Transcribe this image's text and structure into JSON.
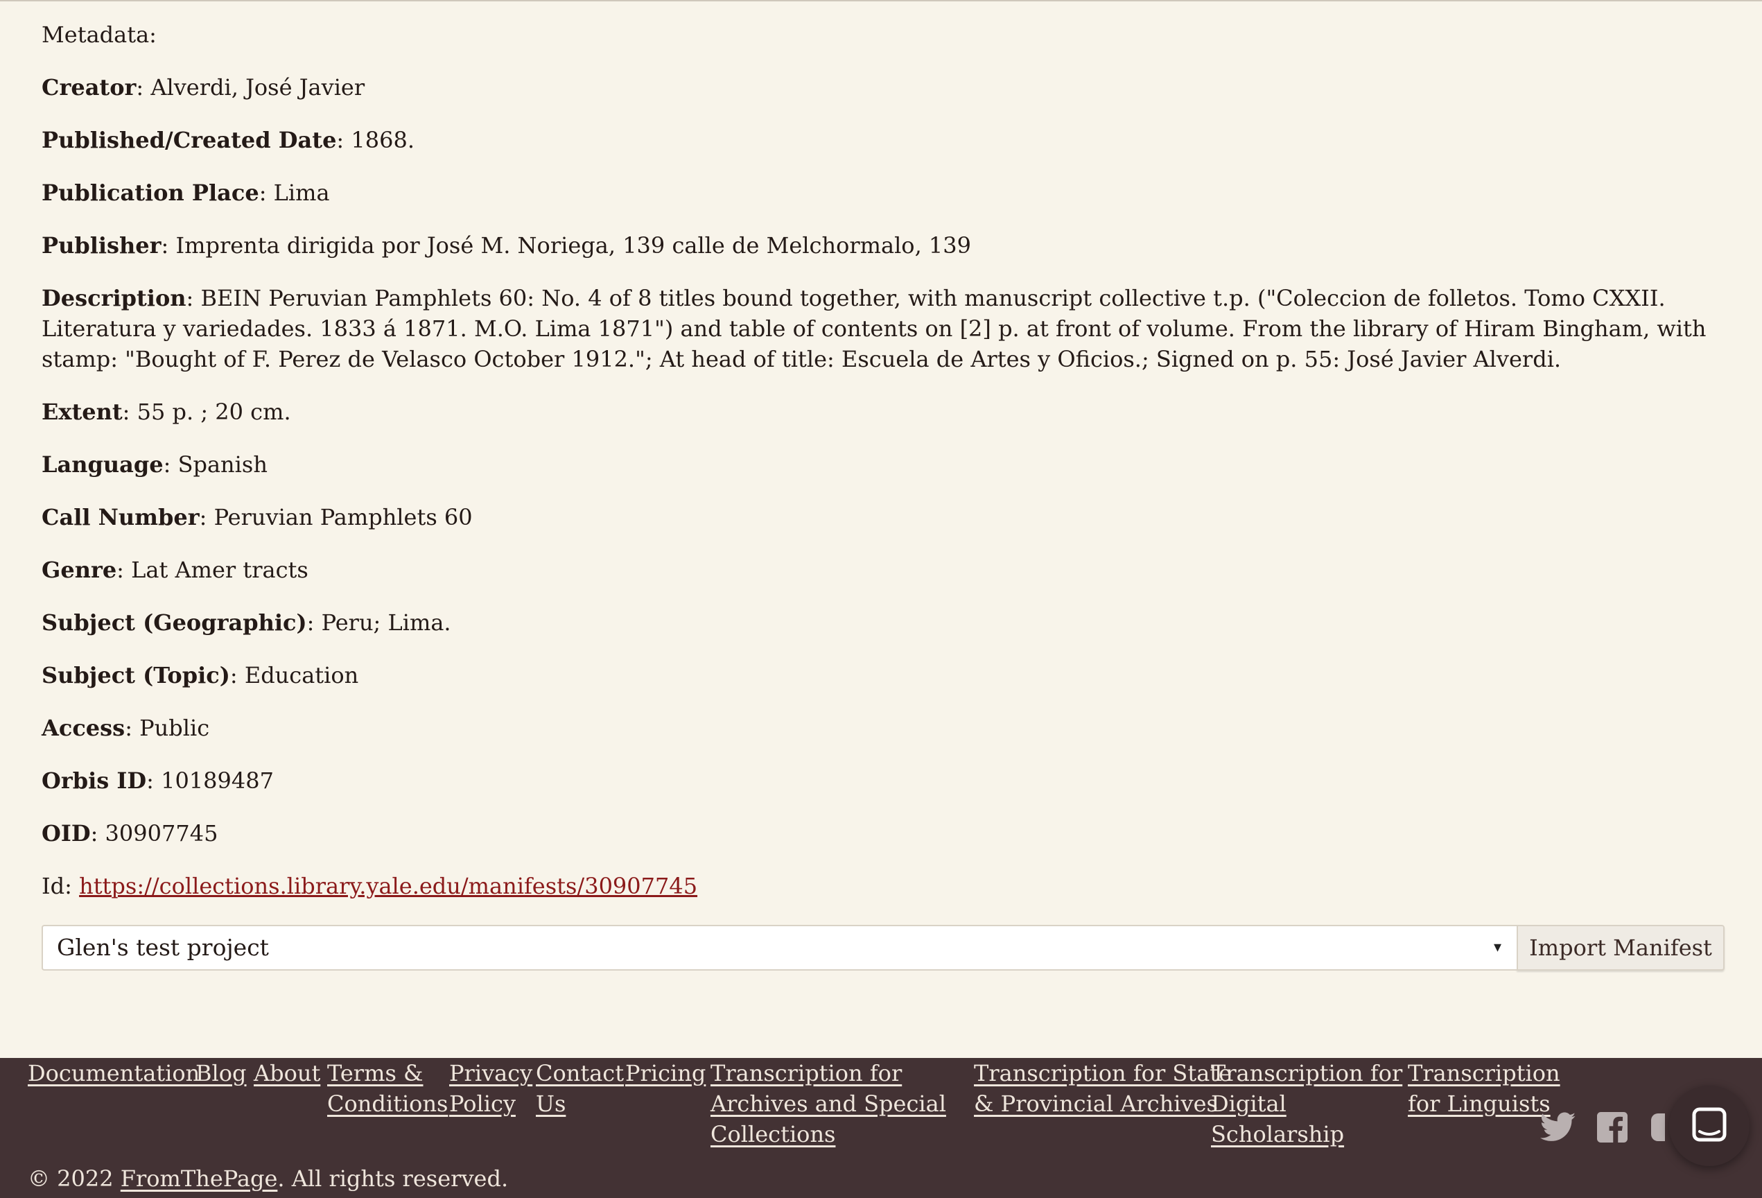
{
  "metadata": {
    "heading": "Metadata:",
    "fields": [
      {
        "label": "Creator",
        "value": ": Alverdi, José Javier"
      },
      {
        "label": "Published/Created Date",
        "value": ": 1868."
      },
      {
        "label": "Publication Place",
        "value": ": Lima"
      },
      {
        "label": "Publisher",
        "value": ": Imprenta dirigida por José M. Noriega, 139 calle de Melchormalo, 139"
      },
      {
        "label": "Description",
        "value": ": BEIN Peruvian Pamphlets 60: No. 4 of 8 titles bound together, with manuscript collective t.p. (\"Coleccion de folletos. Tomo CXXII. Literatura y variedades. 1833 á 1871. M.O. Lima 1871\") and table of contents on [2] p. at front of volume. From the library of Hiram Bingham, with stamp: \"Bought of F. Perez de Velasco October 1912.\"; At head of title: Escuela de Artes y Oficios.; Signed on p. 55: José Javier Alverdi."
      },
      {
        "label": "Extent",
        "value": ": 55 p. ; 20 cm."
      },
      {
        "label": "Language",
        "value": ": Spanish"
      },
      {
        "label": "Call Number",
        "value": ": Peruvian Pamphlets 60"
      },
      {
        "label": "Genre",
        "value": ": Lat Amer tracts"
      },
      {
        "label": "Subject (Geographic)",
        "value": ": Peru; Lima."
      },
      {
        "label": "Subject (Topic)",
        "value": ": Education"
      },
      {
        "label": "Access",
        "value": ": Public"
      },
      {
        "label": "Orbis ID",
        "value": ": 10189487"
      },
      {
        "label": "OID",
        "value": ": 30907745"
      }
    ],
    "id_label": "Id: ",
    "id_link": "https://collections.library.yale.edu/manifests/30907745"
  },
  "import": {
    "selected_project": "Glen's test project",
    "dropdown_arrow": "▾",
    "button_label": "Import Manifest"
  },
  "footer": {
    "links": {
      "documentation": "Documentation",
      "blog": "Blog",
      "about": "About",
      "terms": [
        "Terms &",
        "Conditions"
      ],
      "privacy": [
        "Privacy",
        "Policy"
      ],
      "contact": [
        "Contact",
        "Us"
      ],
      "pricing": "Pricing",
      "archives": [
        "Transcription for",
        "Archives and Special",
        "Collections"
      ],
      "state": [
        "Transcription for State",
        "& Provincial Archives"
      ],
      "digital": [
        "Transcription for",
        "Digital",
        "Scholarship"
      ],
      "linguists": [
        "Transcription",
        "for Linguists"
      ]
    },
    "copyright_prefix": "© 2022 ",
    "copyright_link": "FromThePage",
    "copyright_suffix": ". All rights reserved.",
    "social_icons": [
      "twitter-icon",
      "facebook-icon"
    ],
    "chat_icon": "chat-bubble-icon"
  },
  "colors": {
    "background": "#f8f4ea",
    "footer": "#433234",
    "link": "#8b1a1a"
  }
}
